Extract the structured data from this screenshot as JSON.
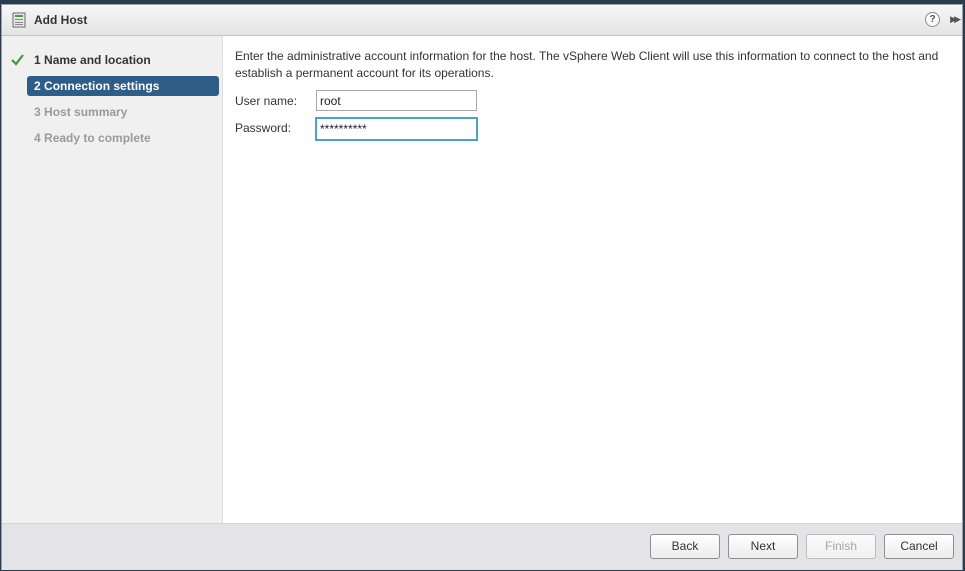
{
  "dialog": {
    "title": "Add Host",
    "help_glyph": "?",
    "expand_glyph": "▶▶"
  },
  "steps": [
    {
      "number": "1",
      "label": "Name and location",
      "state": "completed"
    },
    {
      "number": "2",
      "label": "Connection settings",
      "state": "active"
    },
    {
      "number": "3",
      "label": "Host summary",
      "state": "disabled"
    },
    {
      "number": "4",
      "label": "Ready to complete",
      "state": "disabled"
    }
  ],
  "content": {
    "intro": "Enter the administrative account information for the host. The vSphere Web Client will use this information to connect to the host and establish a permanent account for its operations.",
    "username_label": "User name:",
    "username_value": "root",
    "password_label": "Password:",
    "password_value": "**********"
  },
  "footer": {
    "back": "Back",
    "next": "Next",
    "finish": "Finish",
    "cancel": "Cancel"
  },
  "colors": {
    "active_step": "#2e5d87",
    "check": "#3a9a3a",
    "focus_border": "#4aa3cf"
  }
}
